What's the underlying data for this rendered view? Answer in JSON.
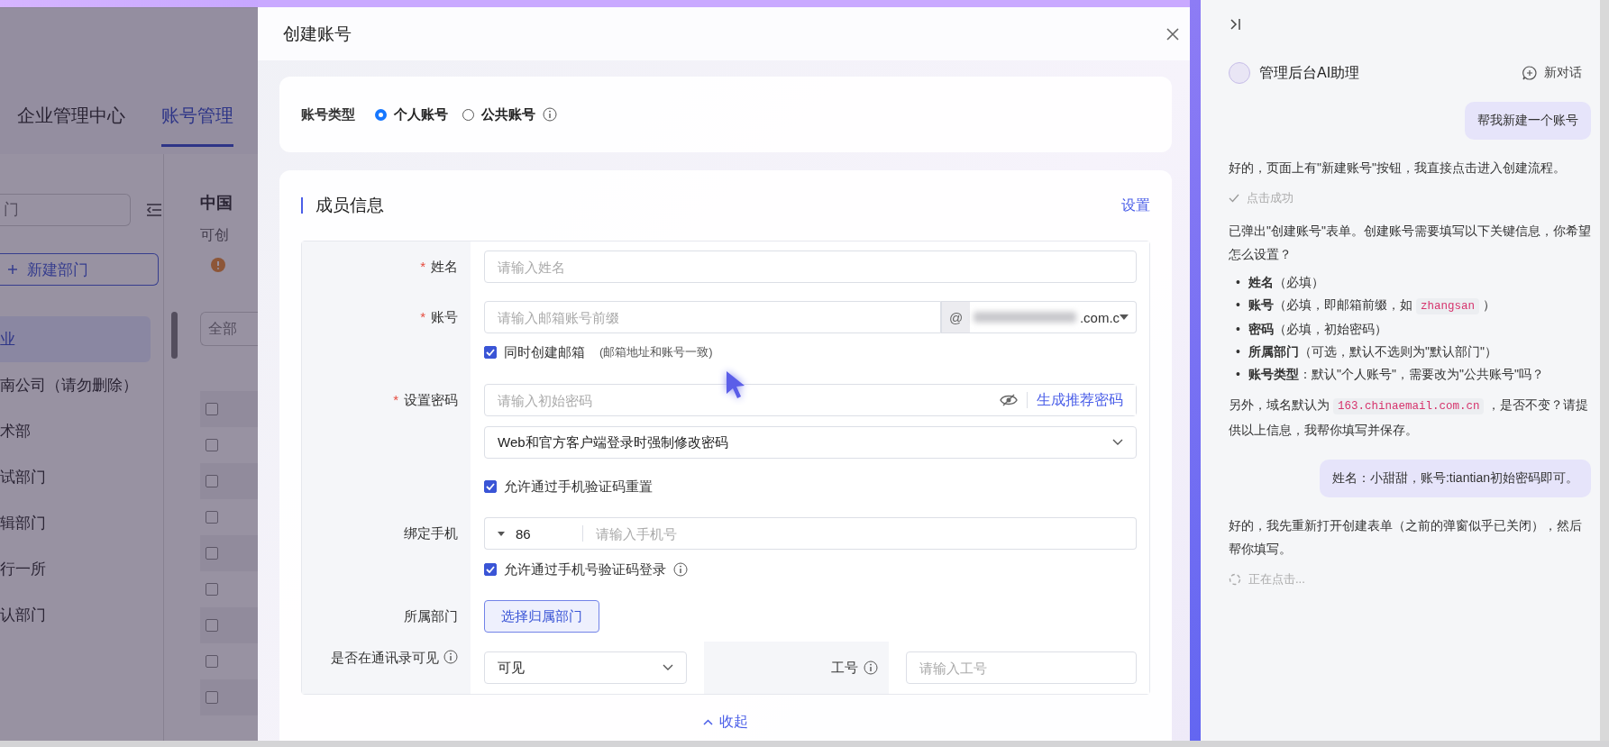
{
  "top_nav": {
    "items": [
      {
        "label": "企业管理中心",
        "selected": false
      },
      {
        "label": "账号管理",
        "selected": true
      }
    ]
  },
  "sidebar": {
    "search": {
      "placeholder": "门"
    },
    "new_button": "新建部门",
    "tree": [
      {
        "label": "业",
        "selected": true
      },
      {
        "label": "南公司（请勿删除）",
        "selected": false
      },
      {
        "label": "术部",
        "selected": false
      },
      {
        "label": "试部门",
        "selected": false
      },
      {
        "label": "辑部门",
        "selected": false
      },
      {
        "label": "行一所",
        "selected": false
      },
      {
        "label": "认部门",
        "selected": false
      }
    ]
  },
  "content": {
    "title": "中国",
    "subtitle": "可创",
    "filter": {
      "placeholder": "全部"
    },
    "rows": [
      {
        "checked": false
      },
      {
        "checked": false
      },
      {
        "checked": false
      },
      {
        "checked": false
      },
      {
        "checked": false
      },
      {
        "checked": false
      },
      {
        "checked": false
      },
      {
        "checked": false
      },
      {
        "checked": false
      }
    ]
  },
  "modal": {
    "title": "创建账号",
    "account_type": {
      "label": "账号类型",
      "options": [
        {
          "label": "个人账号",
          "selected": true,
          "info": false
        },
        {
          "label": "公共账号",
          "selected": false,
          "info": true
        }
      ]
    },
    "section": {
      "title": "成员信息",
      "settings_link": "设置",
      "required_mark": "*",
      "fields": [
        {
          "kind": "input",
          "label": "姓名",
          "required": true,
          "placeholder": "请输入姓名"
        },
        {
          "kind": "email",
          "label": "账号",
          "required": true,
          "placeholder": "请输入邮箱账号前缀",
          "at": "@",
          "domain": ".com.c"
        },
        {
          "kind": "checkbox",
          "text": "同时创建邮箱",
          "note": "(邮箱地址和账号一致)",
          "checked": true,
          "info": false
        },
        {
          "kind": "password",
          "label": "设置密码",
          "required": true,
          "placeholder": "请输入初始密码",
          "action": "生成推荐密码"
        },
        {
          "kind": "select",
          "value": "Web和官方客户端登录时强制修改密码"
        },
        {
          "kind": "checkbox",
          "text": "允许通过手机验证码重置",
          "checked": true,
          "info": false
        },
        {
          "kind": "phone",
          "label": "绑定手机",
          "required": false,
          "code": "86",
          "placeholder": "请输入手机号"
        },
        {
          "kind": "checkbox",
          "text": "允许通过手机号验证码登录",
          "checked": true,
          "info": true
        },
        {
          "kind": "button",
          "label": "所属部门",
          "required": false,
          "button": "选择归属部门"
        },
        {
          "kind": "split",
          "label": "是否在通讯录可见",
          "info": true,
          "value": "可见",
          "label2": "工号",
          "info2": true,
          "placeholder": "请输入工号"
        }
      ],
      "collapse": "收起"
    }
  },
  "chat": {
    "title": "管理后台AI助理",
    "new_chat": "新对话",
    "messages": [
      {
        "kind": "user",
        "text": "帮我新建一个账号"
      },
      {
        "kind": "bot",
        "parts": [
          {
            "kind": "text",
            "text": "好的，页面上有\"新建账号\"按钮，我直接点击进入创建流程。"
          }
        ]
      },
      {
        "kind": "status",
        "done": true,
        "text": "点击成功"
      },
      {
        "kind": "bot",
        "parts": [
          {
            "kind": "text",
            "text": "已弹出\"创建账号\"表单。创建账号需要填写以下关键信息，你希望怎么设置？"
          }
        ]
      },
      {
        "kind": "list",
        "bullet": "•",
        "items": [
          {
            "parts": [
              {
                "kind": "bold",
                "text": "姓名"
              },
              {
                "kind": "text",
                "text": "（必填）"
              }
            ]
          },
          {
            "parts": [
              {
                "kind": "bold",
                "text": "账号"
              },
              {
                "kind": "text",
                "text": "（必填，即邮箱前缀，如 "
              },
              {
                "kind": "code",
                "text": "zhangsan"
              },
              {
                "kind": "text",
                "text": " ）"
              }
            ]
          },
          {
            "parts": [
              {
                "kind": "bold",
                "text": "密码"
              },
              {
                "kind": "text",
                "text": "（必填，初始密码）"
              }
            ]
          },
          {
            "parts": [
              {
                "kind": "bold",
                "text": "所属部门"
              },
              {
                "kind": "text",
                "text": "（可选，默认不选则为\"默认部门\"）"
              }
            ]
          },
          {
            "parts": [
              {
                "kind": "bold",
                "text": "账号类型"
              },
              {
                "kind": "text",
                "text": "：默认\"个人账号\"，需要改为\"公共账号\"吗？"
              }
            ]
          }
        ]
      },
      {
        "kind": "bot",
        "parts": [
          {
            "kind": "text",
            "text": "另外，域名默认为 "
          },
          {
            "kind": "code",
            "text": "163.chinaemail.com.cn"
          },
          {
            "kind": "text",
            "text": " ，是否不变？请提供以上信息，我帮你填写并保存。"
          }
        ]
      },
      {
        "kind": "user",
        "text": "姓名：小甜甜，账号:tiantian初始密码即可。"
      },
      {
        "kind": "bot",
        "parts": [
          {
            "kind": "text",
            "text": "好的，我先重新打开创建表单（之前的弹窗似乎已关闭），然后帮你填写。"
          }
        ]
      },
      {
        "kind": "status",
        "done": false,
        "text": "正在点击..."
      }
    ]
  }
}
